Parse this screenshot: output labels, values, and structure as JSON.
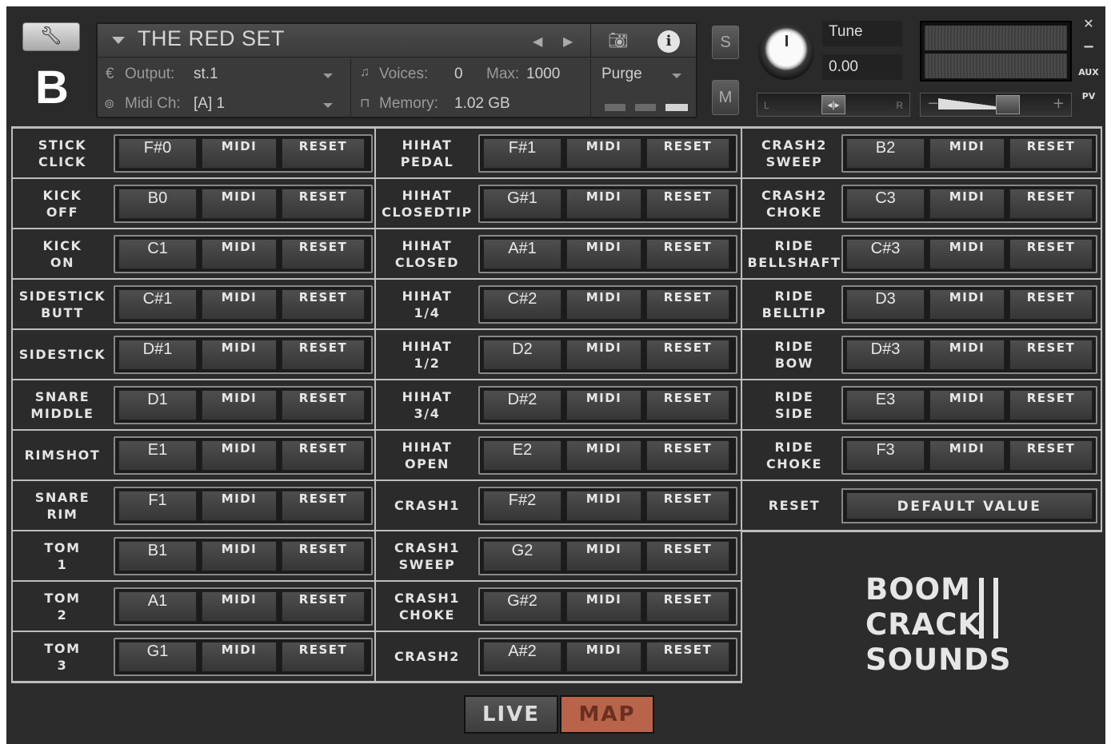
{
  "header": {
    "slot_letter": "B",
    "title": "THE RED SET",
    "output_label": "Output:",
    "output_value": "st.1",
    "midi_label": "Midi Ch:",
    "midi_value": "[A]  1",
    "voices_label": "Voices:",
    "voices_value": "0",
    "max_label": "Max:",
    "max_value": "1000",
    "memory_label": "Memory:",
    "memory_value": "1.02 GB",
    "purge_label": "Purge",
    "solo": "S",
    "mute": "M",
    "tune_label": "Tune",
    "tune_value": "0.00",
    "pan_left": "L",
    "pan_right": "R",
    "vol_minus": "−",
    "vol_plus": "+",
    "close": "✕",
    "minimize": "−",
    "aux": "AUX",
    "pv": "PV"
  },
  "columns": [
    {
      "rows": [
        {
          "name": "STICK\nCLICK",
          "note": "F#0"
        },
        {
          "name": "KICK\nOFF",
          "note": "B0"
        },
        {
          "name": "KICK\nON",
          "note": "C1"
        },
        {
          "name": "SIDESTICK\nBUTT",
          "note": "C#1"
        },
        {
          "name": "SIDESTICK",
          "note": "D#1"
        },
        {
          "name": "SNARE\nMIDDLE",
          "note": "D1"
        },
        {
          "name": "RIMSHOT",
          "note": "E1"
        },
        {
          "name": "SNARE\nRIM",
          "note": "F1"
        },
        {
          "name": "TOM\n1",
          "note": "B1"
        },
        {
          "name": "TOM\n2",
          "note": "A1"
        },
        {
          "name": "TOM\n3",
          "note": "G1"
        }
      ]
    },
    {
      "rows": [
        {
          "name": "HIHAT\nPEDAL",
          "note": "F#1"
        },
        {
          "name": "HIHAT\nCLOSEDTIP",
          "note": "G#1"
        },
        {
          "name": "HIHAT\nCLOSED",
          "note": "A#1"
        },
        {
          "name": "HIHAT\n1/4",
          "note": "C#2"
        },
        {
          "name": "HIHAT\n1/2",
          "note": "D2"
        },
        {
          "name": "HIHAT\n3/4",
          "note": "D#2"
        },
        {
          "name": "HIHAT\nOPEN",
          "note": "E2"
        },
        {
          "name": "CRASH1",
          "note": "F#2"
        },
        {
          "name": "CRASH1\nSWEEP",
          "note": "G2"
        },
        {
          "name": "CRASH1\nCHOKE",
          "note": "G#2"
        },
        {
          "name": "CRASH2",
          "note": "A#2"
        }
      ]
    },
    {
      "rows": [
        {
          "name": "CRASH2\nSWEEP",
          "note": "B2"
        },
        {
          "name": "CRASH2\nCHOKE",
          "note": "C3"
        },
        {
          "name": "RIDE\nBELLSHAFT",
          "note": "C#3"
        },
        {
          "name": "RIDE\nBELLTIP",
          "note": "D3"
        },
        {
          "name": "RIDE\nBOW",
          "note": "D#3"
        },
        {
          "name": "RIDE\nSIDE",
          "note": "E3"
        },
        {
          "name": "RIDE\nCHOKE",
          "note": "F3"
        }
      ]
    }
  ],
  "buttons": {
    "midi": "MIDI",
    "reset": "RESET"
  },
  "reset_row": {
    "name": "RESET",
    "button": "DEFAULT VALUE"
  },
  "logo": {
    "line1": "BOOM",
    "line2": "CRACK",
    "line3": "SOUNDS"
  },
  "tabs": {
    "live": "LIVE",
    "map": "MAP"
  },
  "colors": {
    "map_tab": "#b7644a",
    "live_tab": "#474747",
    "panel": "#2b2b2b",
    "border": "#bdbdbd"
  }
}
